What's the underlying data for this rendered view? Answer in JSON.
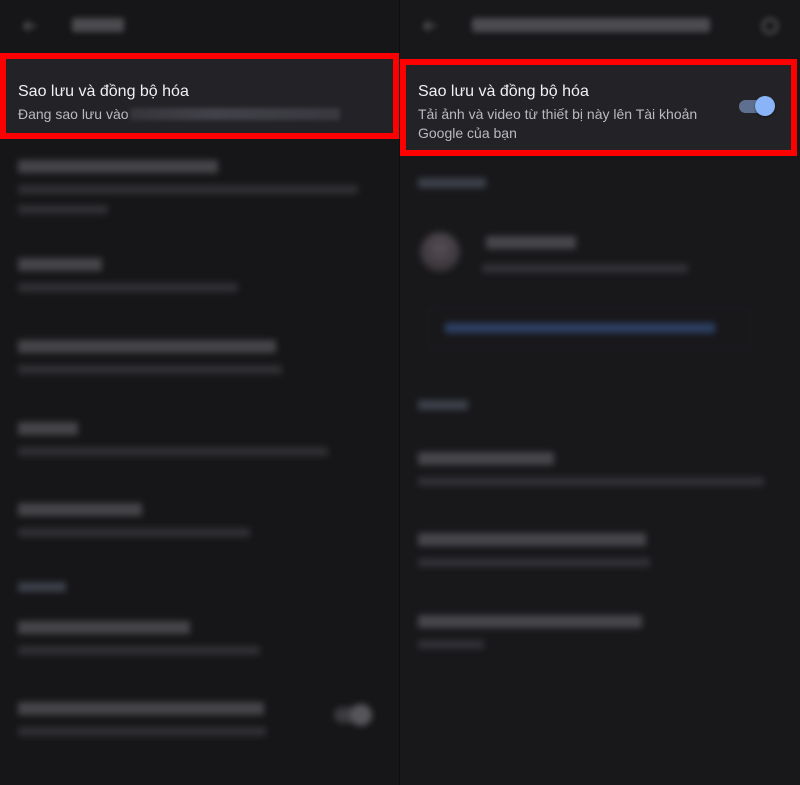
{
  "left_panel": {
    "card": {
      "title": "Sao lưu và đồng bộ hóa",
      "subtitle_prefix": "Đang sao lưu vào"
    }
  },
  "right_panel": {
    "card": {
      "title": "Sao lưu và đồng bộ hóa",
      "subtitle": "Tải ảnh và video từ thiết bị này lên Tài khoản Google của bạn",
      "toggle_on": true
    }
  },
  "colors": {
    "highlight_border": "#ff0000",
    "toggle_thumb": "#8ab4f8",
    "background": "#121214"
  },
  "icons": {
    "left_nav": "back-arrow-icon",
    "right_nav": "back-arrow-icon",
    "right_menu": "help-icon"
  }
}
